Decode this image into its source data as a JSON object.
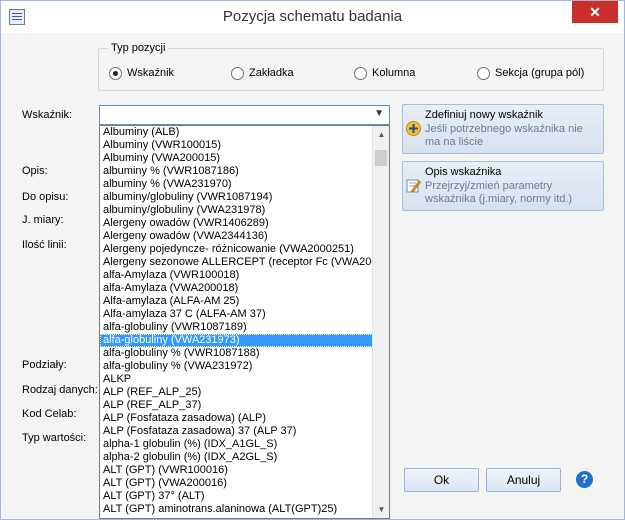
{
  "window": {
    "title": "Pozycja schematu badania",
    "close_glyph": "✕"
  },
  "position_type": {
    "legend": "Typ pozycji",
    "options": [
      {
        "label": "Wskaźnik",
        "selected": true
      },
      {
        "label": "Zakładka",
        "selected": false
      },
      {
        "label": "Kolumna",
        "selected": false
      },
      {
        "label": "Sekcja (grupa pól)",
        "selected": false
      }
    ]
  },
  "labels": {
    "wskaznik": "Wskaźnik:",
    "opis": "Opis:",
    "do_opisu": "Do opisu:",
    "j_miary": "J. miary:",
    "ilosc_linii": "Ilość linii:",
    "podzialy": "Podziały:",
    "rodzaj_danych": "Rodzaj danych:",
    "kod_celab": "Kod Celab:",
    "typ_wartosci": "Typ wartości:"
  },
  "indicator_combo": {
    "value": "",
    "arrow": "▼"
  },
  "indicator_list": {
    "selected_index": 16,
    "items": [
      "Albuminy (ALB)",
      "Albuminy (VWR100015)",
      "Albuminy (VWA200015)",
      "albuminy % (VWR1087186)",
      "albuminy % (VWA231970)",
      "albuminy/globuliny (VWR1087194)",
      "albuminy/globuliny (VWA231978)",
      "Alergeny owadów (VWR1406289)",
      "Alergeny owadów (VWA2344136)",
      "Alergeny pojedyncze- różnicowanie (VWA2000251)",
      "Alergeny sezonowe ALLERCEPT (receptor Fc (VWA200",
      "alfa-Amylaza (VWR100018)",
      "alfa-Amylaza (VWA200018)",
      "Alfa-amylaza (ALFA-AM 25)",
      "Alfa-amylaza 37 C (ALFA-AM 37)",
      "alfa-globuliny (VWR1087189)",
      "alfa-globuliny (VWA231973)",
      "alfa-globuliny % (VWR1087188)",
      "alfa-globuliny % (VWA231972)",
      "ALKP",
      "ALP (REF_ALP_25)",
      "ALP (REF_ALP_37)",
      "ALP (Fosfataza zasadowa) (ALP)",
      "ALP (Fosfataza zasadowa) 37 (ALP 37)",
      "alpha-1 globulin (%) (IDX_A1GL_S)",
      "alpha-2 globulin (%) (IDX_A2GL_S)",
      "ALT (GPT) (VWR100016)",
      "ALT (GPT) (VWA200016)",
      "ALT (GPT) 37° (ALT)",
      "ALT (GPT) aminotrans.alaninowa (ALT(GPT)25)"
    ],
    "scroll_up": "▲",
    "scroll_down": "▼"
  },
  "actions": {
    "define": {
      "title": "Zdefiniuj nowy wskaźnik",
      "desc": "Jeśli potrzebnego wskaźnika nie ma na liście",
      "icon": "plus-icon"
    },
    "describe": {
      "title": "Opis wskaźnika",
      "desc": "Przejrzyj/zmień parametry wskaźnika (j.miary, normy itd.)",
      "icon": "edit-icon"
    }
  },
  "buttons": {
    "ok": "Ok",
    "cancel": "Anuluj",
    "help": "?"
  },
  "colors": {
    "selection": "#3399ff",
    "close": "#c9302c",
    "help": "#1e6fd0"
  }
}
